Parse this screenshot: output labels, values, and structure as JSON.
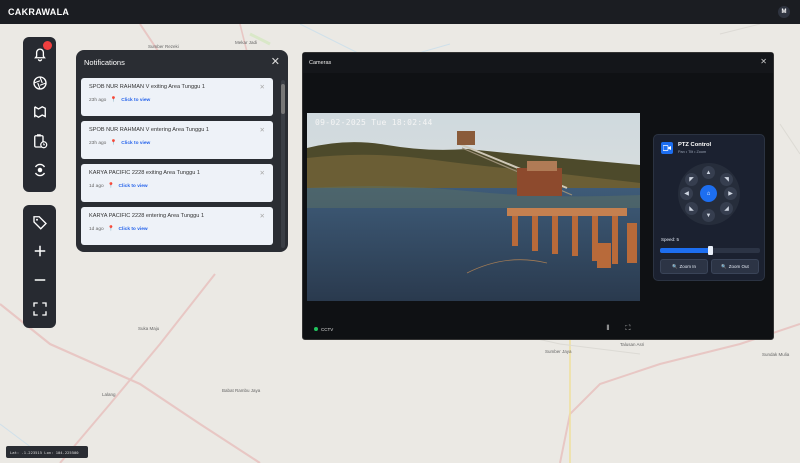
{
  "app": {
    "title": "CAKRAWALA",
    "user_initial": "M"
  },
  "map": {
    "labels": [
      "Sumber Rezeki",
      "Mekar Jadi",
      "Suka Maju",
      "Lalang",
      "Babat Rambu Jaya",
      "Sumber Jaya",
      "Talusan Asri",
      "Sundak Mulia"
    ]
  },
  "toolbar": {
    "top": [
      "bell-icon",
      "aperture-icon",
      "map-icon",
      "clipboard-clock-icon",
      "rotate-target-icon"
    ],
    "bottom": [
      "tag-icon",
      "zoom-in-icon",
      "zoom-out-icon",
      "fullscreen-icon"
    ]
  },
  "notifications": {
    "title": "Notifications",
    "items": [
      {
        "text": "SPOB NUR RAHMAN V exiting Area Tunggu 1",
        "time": "23h ago",
        "link": "Click to view"
      },
      {
        "text": "SPOB NUR RAHMAN V entering Area Tunggu 1",
        "time": "23h ago",
        "link": "Click to view"
      },
      {
        "text": "KARYA PACIFIC 2228 exiting Area Tunggu 1",
        "time": "1d ago",
        "link": "Click to view"
      },
      {
        "text": "KARYA PACIFIC 2228 entering Area Tunggu 1",
        "time": "1d ago",
        "link": "Click to view"
      }
    ]
  },
  "cameras": {
    "title": "Cameras",
    "timestamp": "09-02-2025 Tue 18:02:44",
    "footer_label": "CCTV",
    "ptz": {
      "title": "PTZ Control",
      "subtitle": "Pan • Tilt • Zoom",
      "speed_label": "Speed: 5",
      "speed_fraction": 0.5,
      "zoom_in": "Zoom In",
      "zoom_out": "Zoom Out"
    }
  },
  "coords": {
    "text": "Lat: -1.223515 Lon: 104.225500"
  },
  "colors": {
    "accent": "#1d6ef0",
    "alert": "#ef3f3f",
    "panel": "#2a2d33",
    "topbar": "#1b1d22"
  }
}
